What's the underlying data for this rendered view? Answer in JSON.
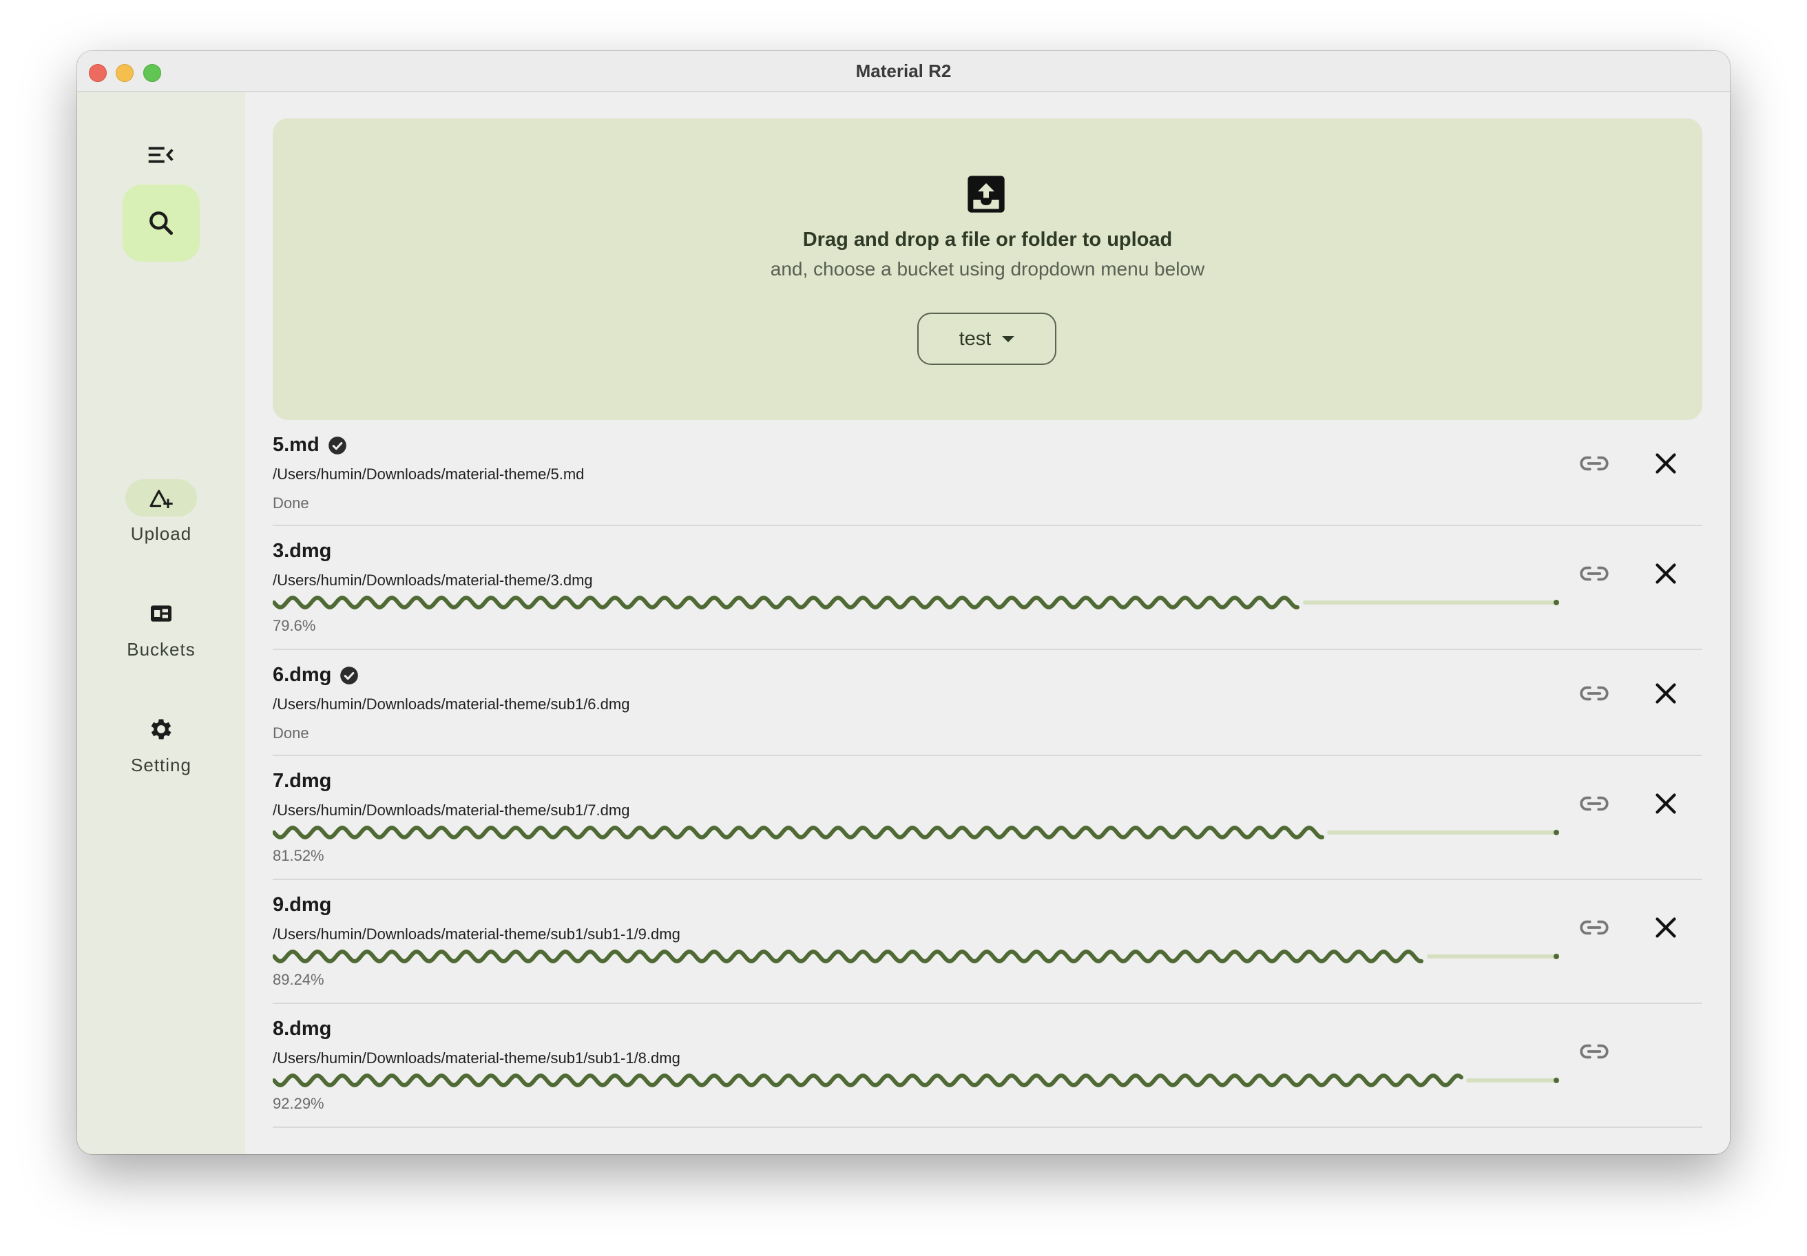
{
  "window": {
    "title": "Material R2"
  },
  "rail": {
    "items": [
      {
        "label": "Upload",
        "icon": "upload-icon",
        "active": true
      },
      {
        "label": "Buckets",
        "icon": "buckets-icon",
        "active": false
      },
      {
        "label": "Setting",
        "icon": "gear-icon",
        "active": false
      }
    ]
  },
  "dropzone": {
    "title": "Drag and drop a file or folder to upload",
    "subtitle": "and, choose a bucket using dropdown menu below",
    "bucket": "test"
  },
  "uploads": [
    {
      "name": "5.md",
      "path": "/Users/humin/Downloads/material-theme/5.md",
      "status": "Done",
      "done": true
    },
    {
      "name": "3.dmg",
      "path": "/Users/humin/Downloads/material-theme/3.dmg",
      "status": "79.6%",
      "progress": 0.796,
      "done": false
    },
    {
      "name": "6.dmg",
      "path": "/Users/humin/Downloads/material-theme/sub1/6.dmg",
      "status": "Done",
      "done": true
    },
    {
      "name": "7.dmg",
      "path": "/Users/humin/Downloads/material-theme/sub1/7.dmg",
      "status": "81.52%",
      "progress": 0.8152,
      "done": false
    },
    {
      "name": "9.dmg",
      "path": "/Users/humin/Downloads/material-theme/sub1/sub1-1/9.dmg",
      "status": "89.24%",
      "progress": 0.8924,
      "done": false
    },
    {
      "name": "8.dmg",
      "path": "/Users/humin/Downloads/material-theme/sub1/sub1-1/8.dmg",
      "status": "92.29%",
      "progress": 0.9229,
      "done": false,
      "close_hidden": true
    }
  ],
  "colors": {
    "accent": "#4f6a34",
    "track": "#d6e0c0",
    "container": "#d8f0b6",
    "dropzone": "#dfe6cb"
  },
  "fab": {
    "icon": "rocket-icon"
  }
}
